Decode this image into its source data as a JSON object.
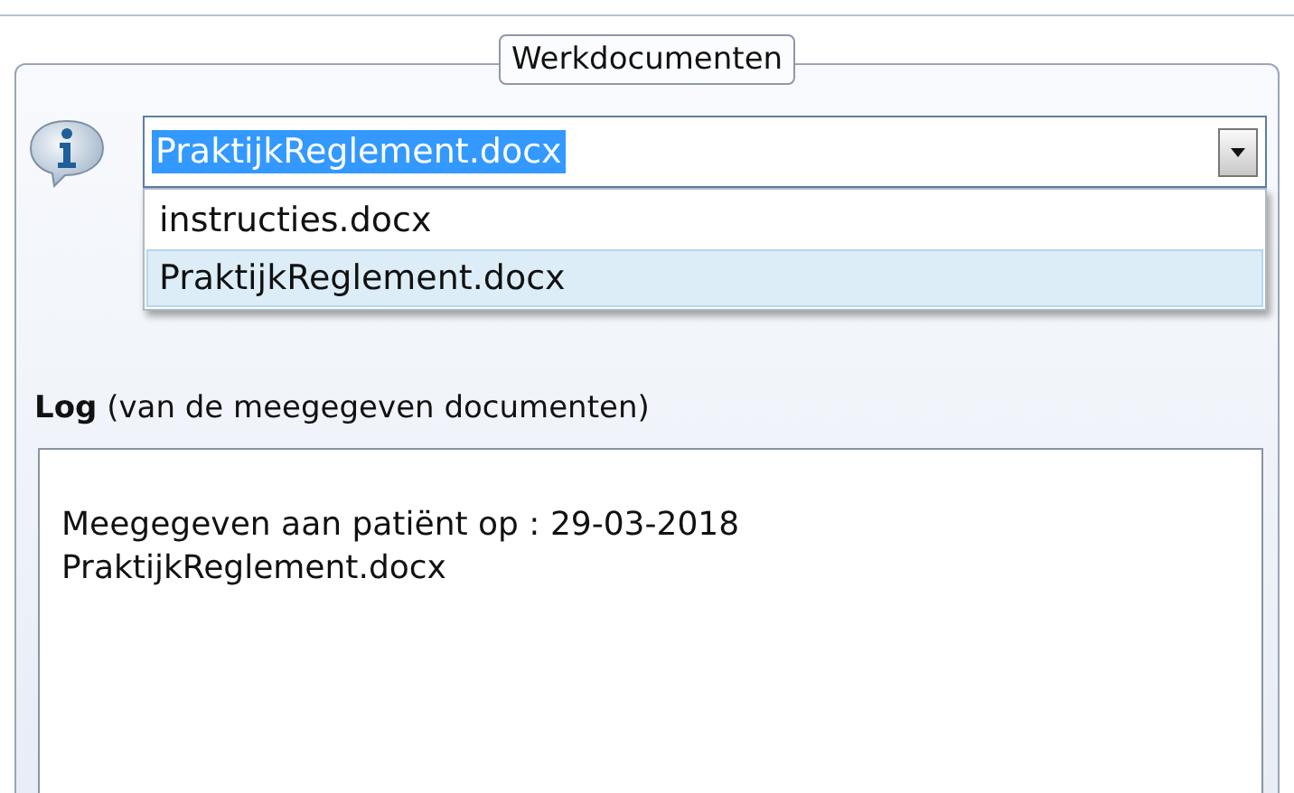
{
  "panel": {
    "title": "Werkdocumenten"
  },
  "combo": {
    "value": "PraktijkReglement.docx",
    "options": [
      {
        "label": "instructies.docx",
        "selected": false
      },
      {
        "label": "PraktijkReglement.docx",
        "selected": true
      }
    ]
  },
  "log": {
    "label": "**Log** (van de meegegeven documenten)",
    "lines": [
      "Meegegeven aan patiënt op : 29-03-2018",
      "PraktijkReglement.docx"
    ]
  }
}
